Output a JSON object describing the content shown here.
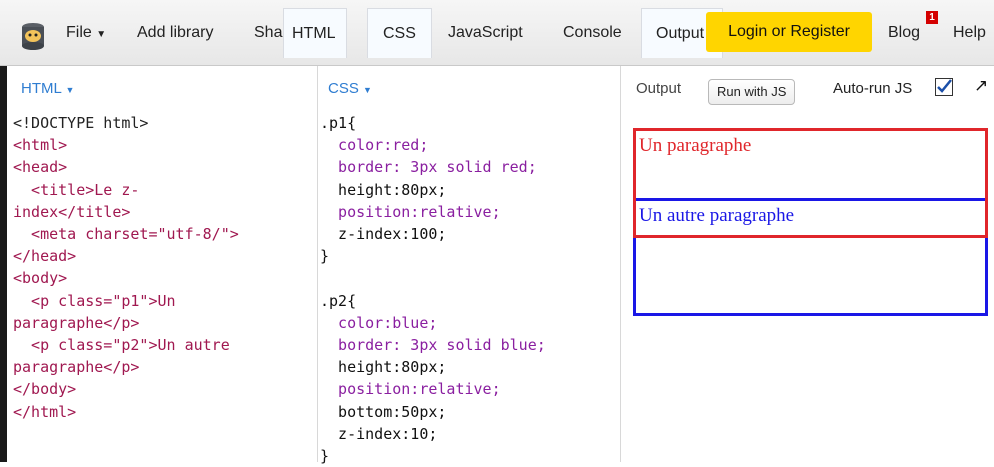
{
  "toolbar": {
    "file": "File",
    "add_library": "Add library",
    "share": "Share",
    "tabs": [
      "HTML",
      "CSS",
      "JavaScript",
      "Console",
      "Output"
    ],
    "login": "Login or Register",
    "blog": "Blog",
    "blog_badge": "1",
    "help": "Help"
  },
  "html_panel": {
    "label": "HTML",
    "lines": [
      "<!DOCTYPE html>",
      "<html>",
      "<head>",
      "  <title>Le z-",
      "index</title>",
      "  <meta charset=\"utf-8/\">",
      "</head>",
      "<body>",
      "  <p class=\"p1\">Un",
      "paragraphe</p>",
      "  <p class=\"p2\">Un autre",
      "paragraphe</p>",
      "</body>",
      "</html>"
    ]
  },
  "css_panel": {
    "label": "CSS",
    "lines": [
      ".p1{",
      "  color:red;",
      "  border: 3px solid red;",
      "  height:80px;",
      "  position:relative;",
      "  z-index:100;",
      "}",
      "",
      ".p2{",
      "  color:blue;",
      "  border: 3px solid blue;",
      "  height:80px;",
      "  position:relative;",
      "  bottom:50px;",
      "  z-index:10;",
      "}"
    ]
  },
  "output_panel": {
    "label": "Output",
    "run_button": "Run with JS",
    "autorun_label": "Auto-run JS",
    "autorun_checked": true,
    "p1_text": "Un paragraphe",
    "p2_text": "Un autre paragraphe"
  },
  "colors": {
    "accent_blue": "#2f7dd1",
    "login_yellow": "#ffd500",
    "p1_red": "#e0262b",
    "p2_blue": "#1a17e6"
  }
}
